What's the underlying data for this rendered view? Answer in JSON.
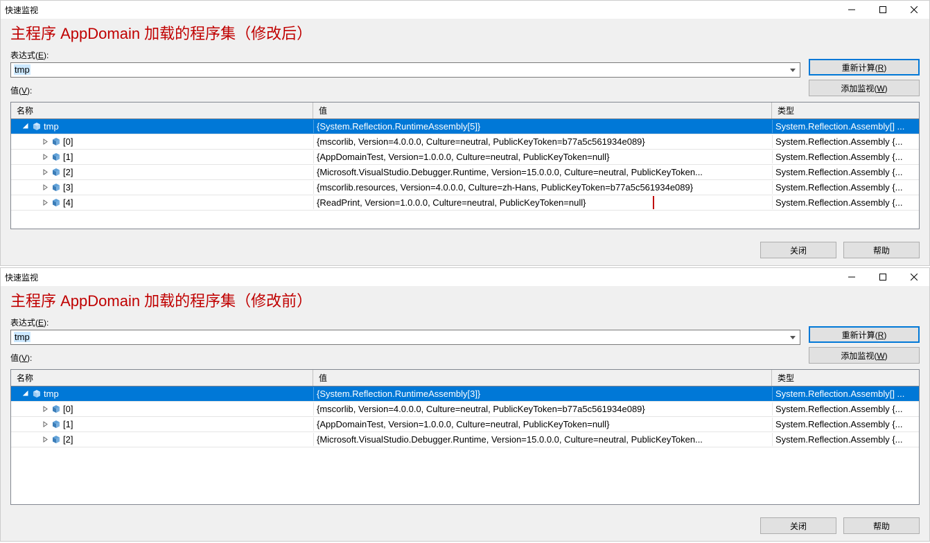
{
  "dialogs": [
    {
      "title": "快速监视",
      "annotation": "主程序 AppDomain 加载的程序集（修改后）",
      "expression_label_prefix": "表达式(",
      "expression_label_key": "E",
      "expression_label_suffix": "):",
      "expression_value": "tmp",
      "value_label_prefix": "值(",
      "value_label_key": "V",
      "value_label_suffix": "):",
      "btn_recalc_prefix": "重新计算(",
      "btn_recalc_key": "R",
      "btn_recalc_suffix": ")",
      "btn_addwatch_prefix": "添加监视(",
      "btn_addwatch_key": "W",
      "btn_addwatch_suffix": ")",
      "btn_close": "关闭",
      "btn_help": "帮助",
      "col_name": "名称",
      "col_value": "值",
      "col_type": "类型",
      "rows": [
        {
          "indent": 0,
          "expanded": true,
          "name": "tmp",
          "value": "{System.Reflection.RuntimeAssembly[5]}",
          "type": "System.Reflection.Assembly[] ...",
          "selected": true,
          "highlight": false
        },
        {
          "indent": 1,
          "expanded": false,
          "name": "[0]",
          "value": "{mscorlib, Version=4.0.0.0, Culture=neutral, PublicKeyToken=b77a5c561934e089}",
          "type": "System.Reflection.Assembly {...",
          "selected": false,
          "highlight": false
        },
        {
          "indent": 1,
          "expanded": false,
          "name": "[1]",
          "value": "{AppDomainTest, Version=1.0.0.0, Culture=neutral, PublicKeyToken=null}",
          "type": "System.Reflection.Assembly {...",
          "selected": false,
          "highlight": false
        },
        {
          "indent": 1,
          "expanded": false,
          "name": "[2]",
          "value": "{Microsoft.VisualStudio.Debugger.Runtime, Version=15.0.0.0, Culture=neutral, PublicKeyToken...",
          "type": "System.Reflection.Assembly {...",
          "selected": false,
          "highlight": false
        },
        {
          "indent": 1,
          "expanded": false,
          "name": "[3]",
          "value": "{mscorlib.resources, Version=4.0.0.0, Culture=zh-Hans, PublicKeyToken=b77a5c561934e089}",
          "type": "System.Reflection.Assembly {...",
          "selected": false,
          "highlight": false
        },
        {
          "indent": 1,
          "expanded": false,
          "name": "[4]",
          "value": "{ReadPrint, Version=1.0.0.0, Culture=neutral, PublicKeyToken=null}",
          "type": "System.Reflection.Assembly {...",
          "selected": false,
          "highlight": true
        }
      ],
      "grid_min_height": 158
    },
    {
      "title": "快速监视",
      "annotation": "主程序 AppDomain 加载的程序集（修改前）",
      "expression_label_prefix": "表达式(",
      "expression_label_key": "E",
      "expression_label_suffix": "):",
      "expression_value": "tmp",
      "value_label_prefix": "值(",
      "value_label_key": "V",
      "value_label_suffix": "):",
      "btn_recalc_prefix": "重新计算(",
      "btn_recalc_key": "R",
      "btn_recalc_suffix": ")",
      "btn_addwatch_prefix": "添加监视(",
      "btn_addwatch_key": "W",
      "btn_addwatch_suffix": ")",
      "btn_close": "关闭",
      "btn_help": "帮助",
      "col_name": "名称",
      "col_value": "值",
      "col_type": "类型",
      "rows": [
        {
          "indent": 0,
          "expanded": true,
          "name": "tmp",
          "value": "{System.Reflection.RuntimeAssembly[3]}",
          "type": "System.Reflection.Assembly[] ...",
          "selected": true,
          "highlight": false
        },
        {
          "indent": 1,
          "expanded": false,
          "name": "[0]",
          "value": "{mscorlib, Version=4.0.0.0, Culture=neutral, PublicKeyToken=b77a5c561934e089}",
          "type": "System.Reflection.Assembly {...",
          "selected": false,
          "highlight": false
        },
        {
          "indent": 1,
          "expanded": false,
          "name": "[1]",
          "value": "{AppDomainTest, Version=1.0.0.0, Culture=neutral, PublicKeyToken=null}",
          "type": "System.Reflection.Assembly {...",
          "selected": false,
          "highlight": false
        },
        {
          "indent": 1,
          "expanded": false,
          "name": "[2]",
          "value": "{Microsoft.VisualStudio.Debugger.Runtime, Version=15.0.0.0, Culture=neutral, PublicKeyToken...",
          "type": "System.Reflection.Assembly {...",
          "selected": false,
          "highlight": false
        }
      ],
      "grid_min_height": 170
    }
  ]
}
